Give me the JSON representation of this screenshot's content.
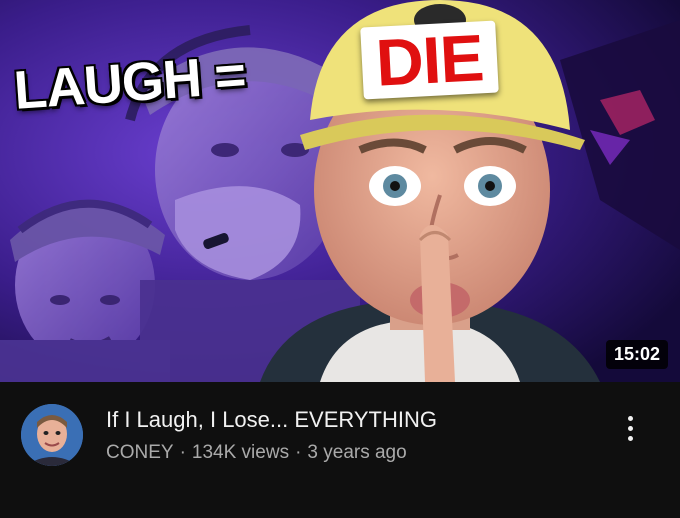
{
  "thumbnail": {
    "overlay_text_left": "LAUGH =",
    "overlay_text_right": "DIE",
    "duration": "15:02"
  },
  "video": {
    "title": "If I Laugh, I Lose... EVERYTHING",
    "channel": "CONEY",
    "separator": "·",
    "views": "134K views",
    "age": "3 years ago"
  },
  "icons": {
    "more": "more-vert-icon",
    "avatar": "channel-avatar"
  },
  "colors": {
    "background": "#0f0f0f",
    "title_text": "#f1f1f1",
    "secondary_text": "#aaaaaa",
    "die_text": "#e01010",
    "thumbnail_bg": "#2a1660"
  }
}
